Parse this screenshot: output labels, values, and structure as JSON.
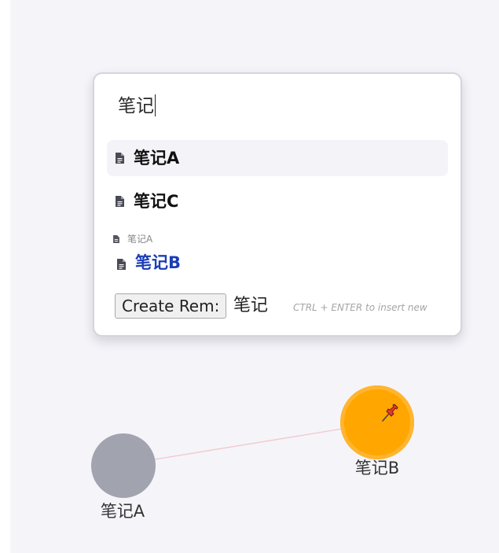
{
  "search": {
    "query": "笔记"
  },
  "results": [
    {
      "title": "笔记A",
      "icon": "document-icon"
    },
    {
      "title": "笔记C",
      "icon": "document-icon"
    },
    {
      "breadcrumb": "笔记A",
      "title": "笔记B",
      "icon": "document-icon"
    }
  ],
  "create": {
    "button_label": "Create Rem:",
    "text": "笔记",
    "hint": "CTRL + ENTER to insert new"
  },
  "graph": {
    "nodes": [
      {
        "label": "笔记A",
        "color": "#a1a3ae"
      },
      {
        "label": "笔记B",
        "color": "#ffa600",
        "pinned": true
      }
    ],
    "edge_color": "#f0c8cc"
  },
  "colors": {
    "canvas_bg": "#f5f4f9",
    "selected_row_bg": "#f3f3f8",
    "link_blue": "#1b3db8"
  }
}
